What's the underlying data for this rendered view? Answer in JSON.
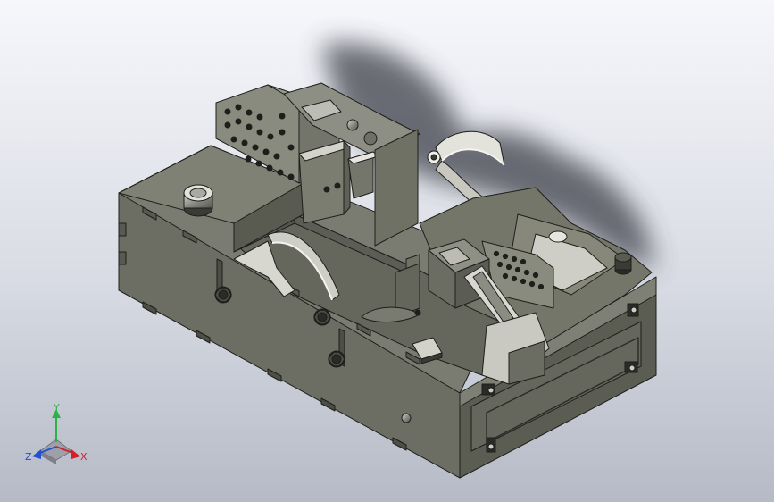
{
  "colors": {
    "background_top": "#f6f7fb",
    "background_bottom": "#b7bcc8",
    "body_main": "#6e6f64",
    "body_dark": "#4f5048",
    "body_light": "#8a8b7f",
    "edge": "#1e1f1b",
    "highlight": "#f2f2ee",
    "axis_x": "#d4202a",
    "axis_y": "#2bb34a",
    "axis_z": "#2450d0"
  },
  "triad": {
    "x_label": "X",
    "y_label": "Y",
    "z_label": "Z",
    "x_icon": "arrow-x-icon",
    "y_icon": "arrow-y-icon",
    "z_icon": "arrow-z-icon"
  }
}
